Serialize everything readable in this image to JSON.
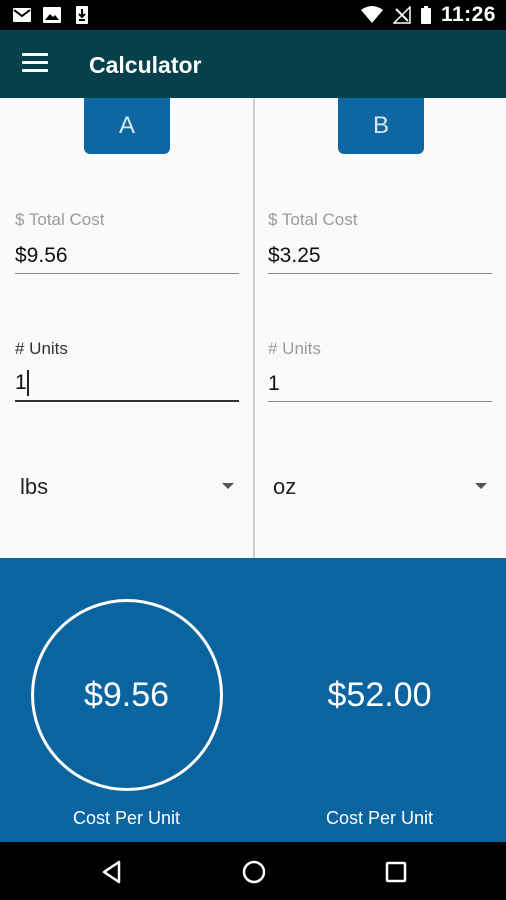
{
  "status_bar": {
    "time": "11:26"
  },
  "app_bar": {
    "title": "Calculator"
  },
  "column_a": {
    "tab_label": "A",
    "total_cost_label": "$ Total Cost",
    "total_cost_value": "$9.56",
    "units_label": "# Units",
    "units_value": "1",
    "unit_selected": "lbs"
  },
  "column_b": {
    "tab_label": "B",
    "total_cost_label": "$ Total Cost",
    "total_cost_value": "$3.25",
    "units_label": "# Units",
    "units_value": "1",
    "unit_selected": "oz"
  },
  "results": {
    "a_value": "$9.56",
    "a_caption": "Cost Per Unit",
    "b_value": "$52.00",
    "b_caption": "Cost Per Unit"
  },
  "colors": {
    "app_bar": "#06404a",
    "accent_blue": "#0a64a0",
    "tab_blue": "#0e67a3"
  }
}
